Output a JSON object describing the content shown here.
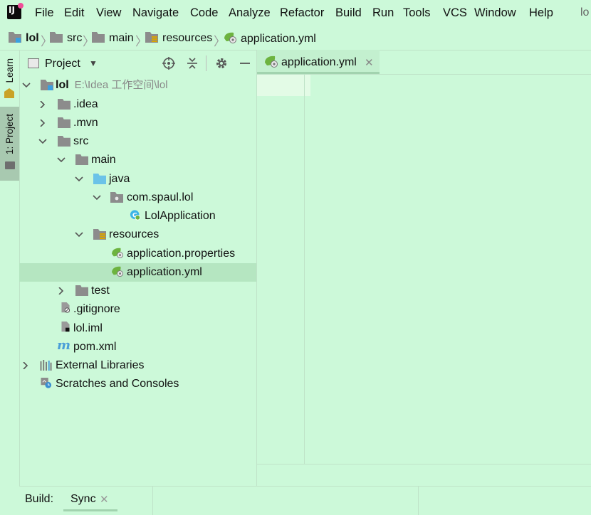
{
  "app": {
    "icon": "intellij-idea-icon",
    "icon_letters": "IJ",
    "menus": [
      "File",
      "Edit",
      "View",
      "Navigate",
      "Code",
      "Analyze",
      "Refactor",
      "Build",
      "Run",
      "Tools",
      "VCS",
      "Window",
      "Help"
    ],
    "title_overflow": "lo"
  },
  "breadcrumb": {
    "items": [
      "lol",
      "src",
      "main",
      "resources",
      "application.yml"
    ]
  },
  "tool_window_strip": {
    "learn_label": "Learn",
    "project_label": "1: Project"
  },
  "project_panel": {
    "title": "Project",
    "tree": [
      {
        "label": "lol",
        "path": "E:\\Idea 工作空间\\lol",
        "icon": "module-folder-icon",
        "expanded": true,
        "bold": true
      },
      {
        "label": ".idea",
        "icon": "folder-icon",
        "expanded": false
      },
      {
        "label": ".mvn",
        "icon": "folder-icon",
        "expanded": false
      },
      {
        "label": "src",
        "icon": "folder-icon",
        "expanded": true
      },
      {
        "label": "main",
        "icon": "folder-icon",
        "expanded": true
      },
      {
        "label": "java",
        "icon": "source-folder-icon",
        "expanded": true
      },
      {
        "label": "com.spaul.lol",
        "icon": "package-icon",
        "expanded": true
      },
      {
        "label": "LolApplication",
        "icon": "spring-class-icon"
      },
      {
        "label": "resources",
        "icon": "resources-folder-icon",
        "expanded": true
      },
      {
        "label": "application.properties",
        "icon": "spring-config-icon"
      },
      {
        "label": "application.yml",
        "icon": "spring-config-icon",
        "selected": true
      },
      {
        "label": "test",
        "icon": "folder-icon",
        "expanded": false
      },
      {
        "label": ".gitignore",
        "icon": "ignore-file-icon"
      },
      {
        "label": "lol.iml",
        "icon": "iml-file-icon"
      },
      {
        "label": "pom.xml",
        "icon": "maven-icon"
      },
      {
        "label": "External Libraries",
        "icon": "libraries-icon",
        "expanded": false
      },
      {
        "label": "Scratches and Consoles",
        "icon": "scratches-icon"
      }
    ]
  },
  "editor": {
    "tabs": [
      {
        "label": "application.yml",
        "active": true
      }
    ]
  },
  "bottom_bar": {
    "build_label": "Build:",
    "tabs": [
      {
        "label": "Sync"
      }
    ]
  },
  "colors": {
    "background": "#CCF9D9",
    "selection": "#B5E6C1",
    "tab_underline": "#A2D3AF",
    "spring_green": "#6DB33F"
  }
}
